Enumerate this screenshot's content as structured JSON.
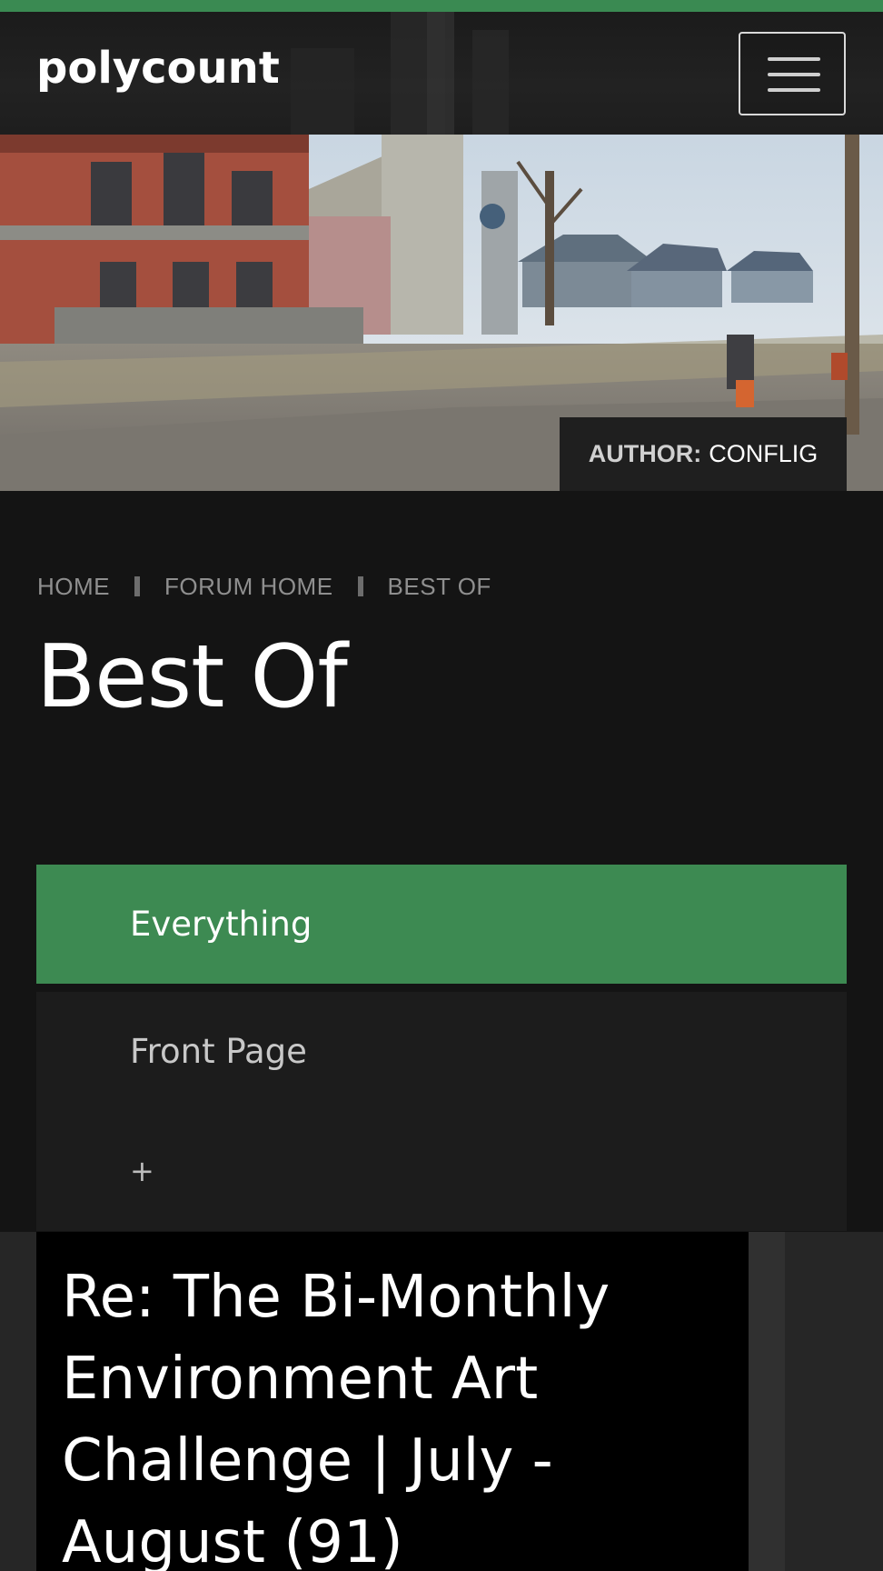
{
  "header": {
    "logo_text": "polycount",
    "menu_button_label": "menu"
  },
  "hero": {
    "author_label": "AUTHOR:",
    "author_name": "CONFLIG"
  },
  "breadcrumb": {
    "items": [
      "HOME",
      "FORUM HOME",
      "BEST OF"
    ]
  },
  "page": {
    "title": "Best Of"
  },
  "tabs": [
    {
      "label": "Everything",
      "active": true
    },
    {
      "label": "Front Page",
      "active": false
    },
    {
      "label": "+",
      "active": false
    }
  ],
  "posts": [
    {
      "title": "Re: The Bi-Monthly Environment Art Challenge | July - August (91)"
    }
  ],
  "colors": {
    "accent": "#3a8a52",
    "background": "#141414",
    "tab_inactive": "#1c1c1c"
  }
}
